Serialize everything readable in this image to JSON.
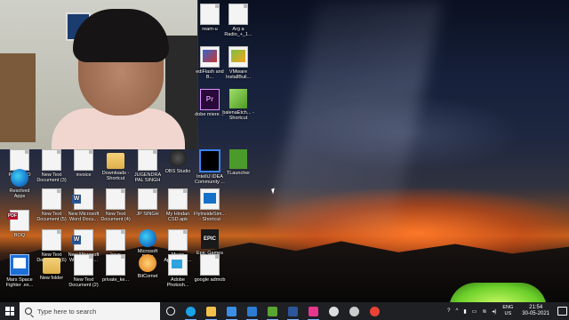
{
  "desktop": {
    "icons": [
      {
        "label": "PowerISO",
        "type": "doc"
      },
      {
        "label": "New Text Document (3)",
        "type": "doc"
      },
      {
        "label": "invoice",
        "type": "doc"
      },
      {
        "label": "Downloads - Shortcut",
        "type": "folder"
      },
      {
        "label": "JUGENDRA PAL SINGH",
        "type": "doc"
      },
      {
        "label": "OBS Studio",
        "type": "obs"
      },
      {
        "label": "IntelliJ IDEA Community ...",
        "type": "ij"
      },
      {
        "label": "TLauncher",
        "type": "mc"
      },
      {
        "label": "Resolved Apps",
        "type": "edge"
      },
      {
        "label": "New Text Document (5)",
        "type": "doc"
      },
      {
        "label": "New Microsoft Word Docu...",
        "type": "word"
      },
      {
        "label": "New Text Document (4)",
        "type": "doc"
      },
      {
        "label": "JP SINGH",
        "type": "doc"
      },
      {
        "label": "My Hindan CSD.apk",
        "type": "doc"
      },
      {
        "label": "FlyInsideSim... - Shortcut",
        "type": "fly"
      },
      {
        "label": "BOQ",
        "type": "pdf"
      },
      {
        "label": "New Text Document (6)",
        "type": "doc"
      },
      {
        "label": "New Microsoft Word Docu...",
        "type": "word"
      },
      {
        "label": "keys",
        "type": "doc"
      },
      {
        "label": "Microsoft Edge",
        "type": "edge"
      },
      {
        "label": "Music App_1_1.0...",
        "type": "doc"
      },
      {
        "label": "Epic Games Launcher",
        "type": "epic",
        "glyph": "EPIC"
      },
      {
        "label": "Mars Space Fighter .ex...",
        "type": "screen"
      },
      {
        "label": "New folder",
        "type": "folder"
      },
      {
        "label": "New Text Document (2)",
        "type": "doc"
      },
      {
        "label": "private_ke...",
        "type": "doc"
      },
      {
        "label": "BitComet",
        "type": "bitcomet"
      },
      {
        "label": "Adobe Photosh...",
        "type": "adobe-ps"
      },
      {
        "label": "google admob",
        "type": "doc"
      },
      {
        "label": "ream-u",
        "type": "doc"
      },
      {
        "label": "Arg a Radio_+_1...",
        "type": "doc"
      },
      {
        "label": "ediFlash and B...",
        "type": "flash"
      },
      {
        "label": "VMware InstallBuil...",
        "type": "vm"
      },
      {
        "label": "dobe miere ...",
        "type": "pr",
        "glyph": "Pr"
      },
      {
        "label": "balenaEtch... - Shortcut",
        "type": "cube"
      }
    ]
  },
  "taskbar": {
    "search_placeholder": "Type here to search",
    "apps": [
      {
        "name": "task-view",
        "color": "#ffffff"
      },
      {
        "name": "edge",
        "color": "#1aa3e8"
      },
      {
        "name": "file-explorer",
        "color": "#f3c14b"
      },
      {
        "name": "store",
        "color": "#3a8ee6"
      },
      {
        "name": "mail",
        "color": "#2b7cd3"
      },
      {
        "name": "minecraft",
        "color": "#5aa531"
      },
      {
        "name": "word",
        "color": "#2b579a"
      },
      {
        "name": "intellij",
        "color": "#e8368f"
      },
      {
        "name": "obs",
        "color": "#dddddd"
      },
      {
        "name": "settings",
        "color": "#cccccc"
      },
      {
        "name": "chrome",
        "color": "#ea4335"
      }
    ],
    "tray": {
      "lang_top": "ENG",
      "lang_bottom": "US",
      "time": "21:54",
      "date": "30-05-2021"
    }
  }
}
